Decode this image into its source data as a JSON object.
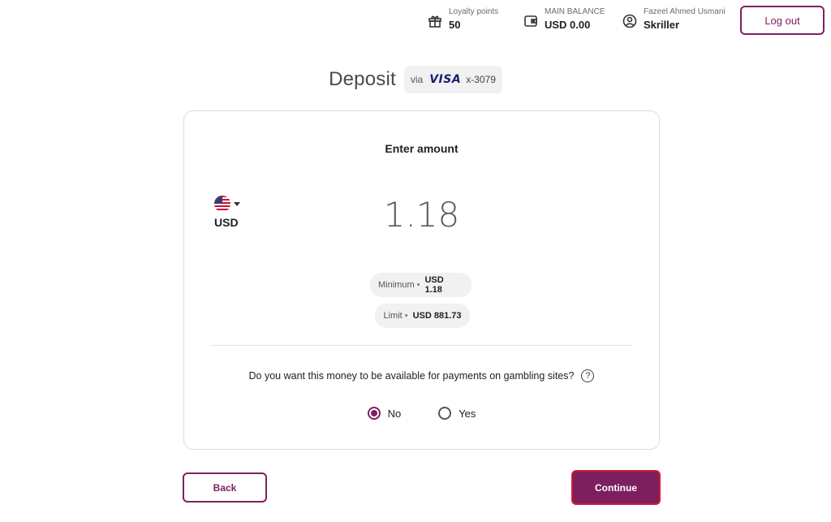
{
  "header": {
    "loyalty": {
      "label": "Loyalty points",
      "value": "50",
      "icon": "gift-icon"
    },
    "balance": {
      "label": "MAIN BALANCE",
      "value": "USD 0.00",
      "icon": "wallet-icon"
    },
    "account": {
      "label": "Fazeel Ahmed Usmani",
      "value": "Skriller",
      "icon": "user-circle-icon"
    },
    "logout_label": "Log out"
  },
  "title": {
    "text": "Deposit",
    "via": "via",
    "card_brand": "VISA",
    "card_mask": "x-3079"
  },
  "card": {
    "heading": "Enter amount",
    "currency_code": "USD",
    "amount": "1.18",
    "minimum": {
      "label": "Minimum",
      "value": "USD 1.18"
    },
    "limit": {
      "label": "Limit",
      "value": "USD 881.73"
    },
    "question": "Do you want this money to be available for payments on gambling sites?",
    "options": [
      {
        "label": "No",
        "selected": true
      },
      {
        "label": "Yes",
        "selected": false
      }
    ]
  },
  "footer": {
    "back_label": "Back",
    "continue_label": "Continue"
  },
  "colors": {
    "brand": "#7d2160",
    "visa": "#1a1f71",
    "highlight": "#d11a3a"
  }
}
